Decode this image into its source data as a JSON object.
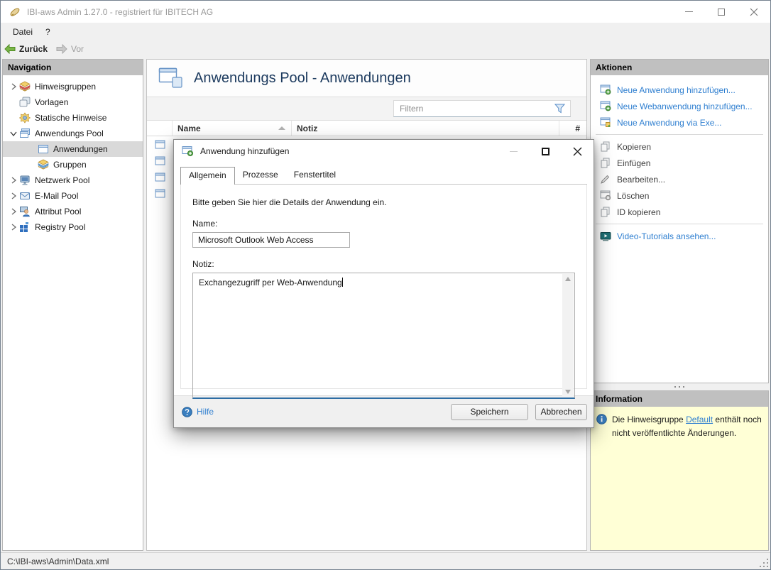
{
  "window": {
    "title": "IBI-aws Admin 1.27.0 - registriert für IBITECH AG"
  },
  "menu": {
    "datei": "Datei",
    "help": "?"
  },
  "toolbar": {
    "back": "Zurück",
    "forward": "Vor"
  },
  "navigation": {
    "header": "Navigation",
    "items": [
      {
        "label": "Hinweisgruppen"
      },
      {
        "label": "Vorlagen"
      },
      {
        "label": "Statische Hinweise"
      },
      {
        "label": "Anwendungs Pool"
      },
      {
        "label": "Anwendungen"
      },
      {
        "label": "Gruppen"
      },
      {
        "label": "Netzwerk Pool"
      },
      {
        "label": "E-Mail Pool"
      },
      {
        "label": "Attribut Pool"
      },
      {
        "label": "Registry Pool"
      }
    ]
  },
  "main": {
    "title": "Anwendungs Pool - Anwendungen",
    "filter": {
      "placeholder": "Filtern"
    },
    "table": {
      "columns": {
        "name": "Name",
        "notiz": "Notiz",
        "count": "#"
      }
    }
  },
  "actions": {
    "header": "Aktionen",
    "new_app": "Neue Anwendung hinzufügen...",
    "new_webapp": "Neue Webanwendung hinzufügen...",
    "new_exe": "Neue Anwendung via Exe...",
    "copy": "Kopieren",
    "paste": "Einfügen",
    "edit": "Bearbeiten...",
    "delete": "Löschen",
    "copy_id": "ID kopieren",
    "video": "Video-Tutorials ansehen..."
  },
  "information": {
    "header": "Information",
    "text_before": "Die Hinweisgruppe ",
    "link": "Default",
    "text_after": " enthält noch nicht veröffentlichte Änderungen."
  },
  "dialog": {
    "title": "Anwendung hinzufügen",
    "tabs": [
      "Allgemein",
      "Prozesse",
      "Fenstertitel"
    ],
    "intro": "Bitte geben Sie hier die Details der Anwendung ein.",
    "name_label": "Name:",
    "name_value": "Microsoft Outlook Web Access",
    "note_label": "Notiz:",
    "note_value": "Exchangezugriff per Web-Anwendung",
    "help": "Hilfe",
    "save": "Speichern",
    "cancel": "Abbrechen"
  },
  "statusbar": {
    "path": "C:\\IBI-aws\\Admin\\Data.xml"
  },
  "colors": {
    "accent_link": "#2f7fd0",
    "info_bg": "#ffffd6",
    "focus_border": "#2d6da4"
  }
}
